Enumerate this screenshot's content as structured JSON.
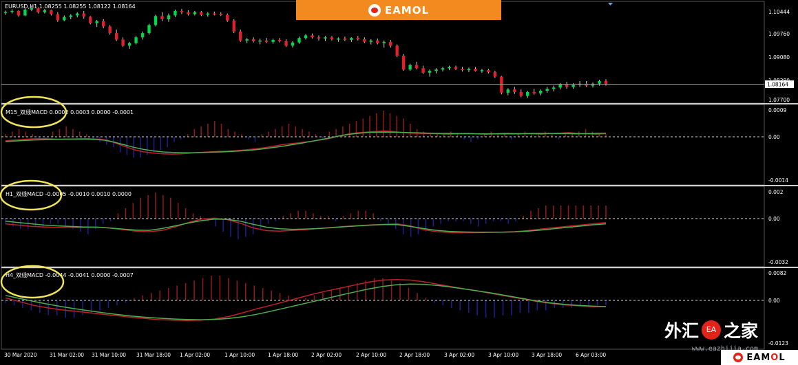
{
  "main_chart": {
    "label": "EURUSD,H1  1.08255 1.08255 1.08122 1.08164",
    "price_ticks": [
      "1.10444",
      "1.09760",
      "1.09080",
      "1.08380",
      "1.07700"
    ],
    "current_price": "1.08164",
    "price_range": [
      1.0762,
      1.1065
    ],
    "current_price_value": 1.08164
  },
  "sub1": {
    "label": "M15_双线MACD 0.0002 0.0003 0.0000 -0.0001",
    "ticks": [
      "0.0009",
      "0.00",
      "-0.0014"
    ]
  },
  "sub2": {
    "label": "H1_双线MACD -0.0005 -0.0010 0.0010 0.0000",
    "ticks": [
      "0.002",
      "0.00",
      "-0.0032"
    ]
  },
  "sub3": {
    "label": "H4_双线MACD -0.0044 -0.0041 0.0000 -0.0007",
    "ticks": [
      "0.0082",
      "0.00",
      "-0.0123"
    ]
  },
  "time_axis": [
    "30 Mar 2020",
    "31 Mar 02:00",
    "31 Mar 10:00",
    "31 Mar 18:00",
    "1 Apr 02:00",
    "1 Apr 10:00",
    "1 Apr 18:00",
    "2 Apr 02:00",
    "2 Apr 10:00",
    "2 Apr 18:00",
    "3 Apr 02:00",
    "3 Apr 10:00",
    "3 Apr 18:00",
    "6 Apr 03:00"
  ],
  "banner": {
    "brand": "EAMOL"
  },
  "watermark": {
    "text_left": "外汇",
    "seal": "EA",
    "text_right": "之家",
    "url": "www.eazhijia.com"
  },
  "corner_logo": {
    "brand_a": "EAM",
    "brand_o": "O",
    "brand_b": "L"
  },
  "colors": {
    "bull": "#00d84a",
    "bear": "#e0202a",
    "hist_up": "#8b1a1a",
    "hist_down": "#1a1f8b",
    "macd_red": "#c0202a",
    "signal_green": "#4caf50",
    "ellipse": "#f0e45a",
    "banner": "#f28a1f"
  },
  "candles": [
    [
      1.104,
      1.1045,
      1.1032,
      1.1041
    ],
    [
      1.1041,
      1.1049,
      1.1036,
      1.1044
    ],
    [
      1.1044,
      1.1046,
      1.1026,
      1.103
    ],
    [
      1.103,
      1.1052,
      1.1028,
      1.1048
    ],
    [
      1.1048,
      1.106,
      1.1043,
      1.1052
    ],
    [
      1.1052,
      1.1055,
      1.1036,
      1.104
    ],
    [
      1.104,
      1.105,
      1.1036,
      1.1046
    ],
    [
      1.1046,
      1.1048,
      1.103,
      1.1034
    ],
    [
      1.1034,
      1.104,
      1.101,
      1.1015
    ],
    [
      1.1015,
      1.103,
      1.1012,
      1.1025
    ],
    [
      1.1025,
      1.1034,
      1.1018,
      1.103
    ],
    [
      1.103,
      1.104,
      1.1024,
      1.1036
    ],
    [
      1.1036,
      1.1044,
      1.102,
      1.1026
    ],
    [
      1.1026,
      1.1028,
      1.1002,
      1.1006
    ],
    [
      1.1006,
      1.1016,
      1.0994,
      1.1012
    ],
    [
      1.1012,
      1.1018,
      1.099,
      1.0996
    ],
    [
      1.0996,
      1.1,
      1.097,
      1.0975
    ],
    [
      1.0975,
      1.0986,
      1.095,
      1.0955
    ],
    [
      1.0955,
      1.0962,
      1.0932,
      1.0936
    ],
    [
      1.0936,
      1.0948,
      1.0926,
      1.0944
    ],
    [
      1.0944,
      1.0966,
      1.094,
      1.0962
    ],
    [
      1.0962,
      1.098,
      1.0955,
      1.0975
    ],
    [
      1.0975,
      1.1004,
      1.097,
      1.1
    ],
    [
      1.1,
      1.1032,
      1.0996,
      1.1028
    ],
    [
      1.1028,
      1.104,
      1.1012,
      1.1018
    ],
    [
      1.1018,
      1.1036,
      1.101,
      1.103
    ],
    [
      1.103,
      1.1048,
      1.1025,
      1.1044
    ],
    [
      1.1044,
      1.105,
      1.1034,
      1.104
    ],
    [
      1.104,
      1.1046,
      1.103,
      1.1034
    ],
    [
      1.1034,
      1.1044,
      1.103,
      1.104
    ],
    [
      1.104,
      1.1044,
      1.1028,
      1.1032
    ],
    [
      1.1032,
      1.104,
      1.1026,
      1.1036
    ],
    [
      1.1036,
      1.1042,
      1.103,
      1.1034
    ],
    [
      1.1034,
      1.104,
      1.1028,
      1.1032
    ],
    [
      1.1032,
      1.1036,
      1.101,
      1.1014
    ],
    [
      1.1014,
      1.1018,
      1.0975,
      1.098
    ],
    [
      1.098,
      1.0986,
      1.0948,
      1.0952
    ],
    [
      1.0952,
      1.096,
      1.0944,
      1.0956
    ],
    [
      1.0956,
      1.0962,
      1.0946,
      1.095
    ],
    [
      1.095,
      1.0958,
      1.094,
      1.0952
    ],
    [
      1.0952,
      1.096,
      1.0944,
      1.0948
    ],
    [
      1.0948,
      1.0958,
      1.0942,
      1.0954
    ],
    [
      1.0954,
      1.096,
      1.0946,
      1.095
    ],
    [
      1.095,
      1.0956,
      1.0932,
      1.0936
    ],
    [
      1.0936,
      1.095,
      1.093,
      1.0946
    ],
    [
      1.0946,
      1.0964,
      1.0942,
      1.096
    ],
    [
      1.096,
      1.0972,
      1.0955,
      1.0968
    ],
    [
      1.0968,
      1.0974,
      1.0958,
      1.0962
    ],
    [
      1.0962,
      1.0968,
      1.0952,
      1.0958
    ],
    [
      1.0958,
      1.0966,
      1.095,
      1.0962
    ],
    [
      1.0962,
      1.0966,
      1.0952,
      1.0956
    ],
    [
      1.0956,
      1.0962,
      1.0948,
      1.0958
    ],
    [
      1.0958,
      1.0964,
      1.095,
      1.0954
    ],
    [
      1.0954,
      1.0962,
      1.0948,
      1.096
    ],
    [
      1.096,
      1.0966,
      1.0952,
      1.0956
    ],
    [
      1.0956,
      1.0962,
      1.0944,
      1.0948
    ],
    [
      1.0948,
      1.0956,
      1.094,
      1.0952
    ],
    [
      1.0952,
      1.0958,
      1.094,
      1.0944
    ],
    [
      1.0944,
      1.0952,
      1.093,
      1.0948
    ],
    [
      1.0948,
      1.0954,
      1.093,
      1.0936
    ],
    [
      1.0936,
      1.094,
      1.09,
      1.0905
    ],
    [
      1.0905,
      1.091,
      1.0858,
      1.0862
    ],
    [
      1.0862,
      1.088,
      1.0858,
      1.0876
    ],
    [
      1.0876,
      1.0886,
      1.0862,
      1.0866
    ],
    [
      1.0866,
      1.0874,
      1.0848,
      1.0852
    ],
    [
      1.0852,
      1.0862,
      1.084,
      1.0858
    ],
    [
      1.0858,
      1.0866,
      1.085,
      1.0862
    ],
    [
      1.0862,
      1.087,
      1.0856,
      1.0866
    ],
    [
      1.0866,
      1.0874,
      1.086,
      1.087
    ],
    [
      1.087,
      1.0874,
      1.086,
      1.0864
    ],
    [
      1.0864,
      1.087,
      1.0856,
      1.086
    ],
    [
      1.086,
      1.0868,
      1.0854,
      1.0864
    ],
    [
      1.0864,
      1.087,
      1.0856,
      1.0858
    ],
    [
      1.0858,
      1.0864,
      1.0852,
      1.086
    ],
    [
      1.086,
      1.0864,
      1.085,
      1.0854
    ],
    [
      1.0854,
      1.0858,
      1.0836,
      1.084
    ],
    [
      1.084,
      1.0842,
      1.0785,
      1.079
    ],
    [
      1.079,
      1.0804,
      1.0782,
      1.08
    ],
    [
      1.08,
      1.0808,
      1.0786,
      1.0792
    ],
    [
      1.0792,
      1.08,
      1.0776,
      1.078
    ],
    [
      1.078,
      1.0796,
      1.0774,
      1.0792
    ],
    [
      1.0792,
      1.0802,
      1.0784,
      1.0788
    ],
    [
      1.0788,
      1.08,
      1.0782,
      1.0796
    ],
    [
      1.0796,
      1.0808,
      1.079,
      1.0802
    ],
    [
      1.0802,
      1.0812,
      1.0794,
      1.0806
    ],
    [
      1.0806,
      1.082,
      1.08,
      1.0816
    ],
    [
      1.0816,
      1.0824,
      1.0802,
      1.0808
    ],
    [
      1.0808,
      1.082,
      1.0802,
      1.0814
    ],
    [
      1.0814,
      1.0826,
      1.0808,
      1.0818
    ],
    [
      1.0818,
      1.0826,
      1.0808,
      1.0812
    ],
    [
      1.0812,
      1.0822,
      1.0806,
      1.0818
    ],
    [
      1.0818,
      1.083,
      1.0812,
      1.0826
    ],
    [
      1.0826,
      1.0832,
      1.0812,
      1.0816
    ]
  ],
  "sub_series": {
    "m15_hist": [
      1,
      2,
      3,
      2,
      1,
      -1,
      -1,
      2,
      3,
      4,
      3,
      2,
      1,
      -1,
      -2,
      -3,
      -4,
      -6,
      -7,
      -8,
      -8,
      -7,
      -6,
      -5,
      -4,
      -2,
      -1,
      1,
      3,
      4,
      5,
      6,
      5,
      3,
      2,
      1,
      -1,
      -2,
      1,
      2,
      3,
      4,
      5,
      4,
      3,
      2,
      1,
      -1,
      2,
      3,
      4,
      5,
      6,
      7,
      8,
      9,
      10,
      9,
      8,
      7,
      5,
      3,
      2,
      1,
      1,
      1,
      2,
      1,
      -1,
      -2,
      -1,
      1,
      2,
      1,
      1,
      -1,
      1,
      2,
      1,
      1,
      2,
      1,
      -1,
      1,
      1,
      2,
      3,
      2,
      1,
      1
    ],
    "m15_macd": [
      -1.5,
      -1.2,
      -1.0,
      -0.8,
      -0.7,
      -0.8,
      -1.0,
      -0.9,
      -0.8,
      -0.7,
      -0.9,
      -1.3,
      -2.5,
      -3.8,
      -5.0,
      -5.8,
      -6.2,
      -6.5,
      -6.6,
      -6.5,
      -6.3,
      -6.0,
      -5.8,
      -5.6,
      -5.5,
      -5.3,
      -5.0,
      -4.6,
      -4.2,
      -3.6,
      -3.0,
      -2.6,
      -2.2,
      -1.8,
      -1.3,
      -0.7,
      0.2,
      1.0,
      1.5,
      1.8,
      2.0,
      2.2,
      2.0,
      1.6,
      1.4,
      1.3,
      1.2,
      1.1,
      1.0,
      1.1,
      1.2,
      1.1,
      1.0,
      1.1,
      1.4,
      1.3,
      1.2,
      1.1,
      1.0,
      1.2,
      1.4,
      1.6,
      1.3,
      1.1,
      1.0,
      1.2
    ],
    "m15_signal": [
      -1.8,
      -1.6,
      -1.4,
      -1.2,
      -1.1,
      -1.0,
      -0.9,
      -0.9,
      -0.9,
      -1.0,
      -1.3,
      -2.0,
      -3.0,
      -4.0,
      -4.8,
      -5.4,
      -5.8,
      -6.0,
      -6.1,
      -6.1,
      -6.0,
      -5.9,
      -5.8,
      -5.6,
      -5.4,
      -5.1,
      -4.7,
      -4.2,
      -3.7,
      -3.1,
      -2.5,
      -1.8,
      -1.1,
      -0.4,
      0.4,
      1.0,
      1.4,
      1.7,
      1.8,
      1.8,
      1.7,
      1.6,
      1.5,
      1.4,
      1.3,
      1.3,
      1.2,
      1.2,
      1.1,
      1.1,
      1.1,
      1.1,
      1.1,
      1.2,
      1.3,
      1.3,
      1.2,
      1.2,
      1.1,
      1.2,
      1.3,
      1.4
    ],
    "h1_hist": [
      -2,
      -3,
      -4,
      -4,
      -3,
      -3,
      -2,
      -2,
      -3,
      -4,
      -5,
      -6,
      -4,
      -2,
      -1,
      2,
      4,
      6,
      8,
      9,
      10,
      9,
      8,
      6,
      4,
      2,
      1,
      -1,
      -3,
      -5,
      -7,
      -8,
      -7,
      -6,
      -4,
      -2,
      -1,
      1,
      2,
      3,
      3,
      2,
      1,
      1,
      -1,
      1,
      2,
      3,
      3,
      2,
      -1,
      -2,
      -4,
      -6,
      -7,
      -6,
      -5,
      -3,
      -2,
      -1,
      -1,
      -1,
      -2,
      -3,
      -2,
      -1,
      -1,
      -2,
      -1,
      1,
      3,
      4,
      5,
      5,
      5,
      5,
      5,
      5,
      5,
      5,
      5
    ],
    "h1_macd": [
      -2.0,
      -2.5,
      -3.0,
      -3.2,
      -3.4,
      -3.5,
      -3.4,
      -3.2,
      -3.6,
      -4.2,
      -4.8,
      -5.0,
      -4.5,
      -3.2,
      -1.5,
      -0.2,
      0.2,
      -0.4,
      -1.8,
      -3.6,
      -4.6,
      -4.8,
      -4.5,
      -4.2,
      -3.8,
      -3.4,
      -3.0,
      -2.7,
      -2.4,
      -2.2,
      -2.0,
      -2.8,
      -4.2,
      -5.0,
      -5.3,
      -5.4,
      -5.4,
      -5.3,
      -5.2,
      -5.0,
      -4.6,
      -4.0,
      -3.5,
      -3.0,
      -2.5,
      -2.0,
      -1.5
    ],
    "h1_signal": [
      -1.0,
      -1.5,
      -2.0,
      -2.5,
      -2.8,
      -3.0,
      -3.2,
      -3.3,
      -3.6,
      -4.0,
      -4.4,
      -4.5,
      -3.8,
      -2.8,
      -1.7,
      -0.8,
      -0.2,
      -0.3,
      -1.0,
      -2.2,
      -3.3,
      -3.9,
      -4.1,
      -4.0,
      -3.8,
      -3.5,
      -3.1,
      -2.8,
      -2.5,
      -2.3,
      -2.3,
      -3.0,
      -3.8,
      -4.5,
      -4.9,
      -5.1,
      -5.2,
      -5.2,
      -5.2,
      -5.1,
      -4.8,
      -4.4,
      -3.9,
      -3.4,
      -2.9,
      -2.4,
      -2.0
    ],
    "h4_hist": [
      -1,
      -2,
      -3,
      -4,
      -5,
      -6,
      -6,
      -7,
      -7,
      -6,
      -5,
      -4,
      -3,
      -2,
      -1,
      1,
      2,
      3,
      4,
      5,
      6,
      7,
      8,
      9,
      10,
      10,
      9,
      8,
      7,
      6,
      5,
      4,
      3,
      2,
      1,
      1,
      2,
      3,
      4,
      5,
      6,
      7,
      8,
      9,
      9,
      8,
      7,
      5,
      3,
      1,
      -1,
      -2,
      -3,
      -4,
      -5,
      -6,
      -7,
      -7,
      -6,
      -6,
      -5,
      -5,
      -4,
      -4,
      -3,
      -3,
      -3,
      -2,
      -2,
      -2,
      -2
    ],
    "h4_macd": [
      1.0,
      -0.5,
      -2.0,
      -3.0,
      -3.8,
      -4.4,
      -5.0,
      -5.6,
      -6.2,
      -6.8,
      -7.3,
      -7.8,
      -8.0,
      -8.1,
      -8.0,
      -7.5,
      -6.5,
      -5.0,
      -3.4,
      -2.0,
      -0.5,
      1.0,
      2.5,
      3.8,
      5.0,
      6.2,
      7.4,
      8.2,
      8.4,
      8.2,
      7.5,
      6.5,
      5.5,
      4.5,
      3.6,
      2.6,
      1.6,
      0.6,
      -0.4,
      -1.2,
      -1.8,
      -2.2,
      -2.5,
      -2.5
    ],
    "h4_signal": [
      2.0,
      0.8,
      -0.4,
      -1.5,
      -2.5,
      -3.4,
      -4.2,
      -5.0,
      -5.7,
      -6.3,
      -6.8,
      -7.2,
      -7.5,
      -7.7,
      -7.8,
      -7.7,
      -7.3,
      -6.6,
      -5.6,
      -4.4,
      -3.1,
      -1.8,
      -0.5,
      0.8,
      2.1,
      3.4,
      4.6,
      5.6,
      6.3,
      6.6,
      6.5,
      6.0,
      5.3,
      4.5,
      3.7,
      2.8,
      1.8,
      0.8,
      -0.2,
      -1.0,
      -1.6,
      -2.0,
      -2.3,
      -2.5
    ]
  }
}
